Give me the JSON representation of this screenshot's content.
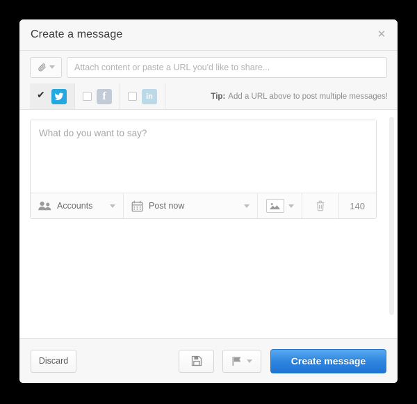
{
  "modal": {
    "title": "Create a message",
    "close_icon": "close-icon"
  },
  "attach": {
    "button_icon": "paperclip-icon",
    "url_placeholder": "Attach content or paste a URL you'd like to share..."
  },
  "networks": {
    "tabs": [
      {
        "name": "twitter",
        "label": "Twitter",
        "checked": true,
        "color": "#25a8e0"
      },
      {
        "name": "facebook",
        "label": "Facebook",
        "checked": false,
        "color": "#c3cbd8"
      },
      {
        "name": "linkedin",
        "label": "LinkedIn",
        "checked": false,
        "color": "#bcd9e8"
      }
    ],
    "tip_prefix": "Tip:",
    "tip_text": "Add a URL above to post multiple messages!"
  },
  "composer": {
    "placeholder": "What do you want to say?",
    "value": "",
    "toolbar": {
      "accounts_label": "Accounts",
      "accounts_icon": "people-icon",
      "schedule_label": "Post now",
      "schedule_icon": "calendar-icon",
      "media_icon": "image-icon",
      "trash_icon": "trash-icon",
      "char_count": "140"
    }
  },
  "footer": {
    "discard_label": "Discard",
    "save_icon": "floppy-disk-icon",
    "flag_icon": "flag-icon",
    "create_label": "Create message"
  },
  "colors": {
    "accent": "#2f86e0",
    "twitter": "#25a8e0",
    "panel": "#f7f7f7"
  }
}
